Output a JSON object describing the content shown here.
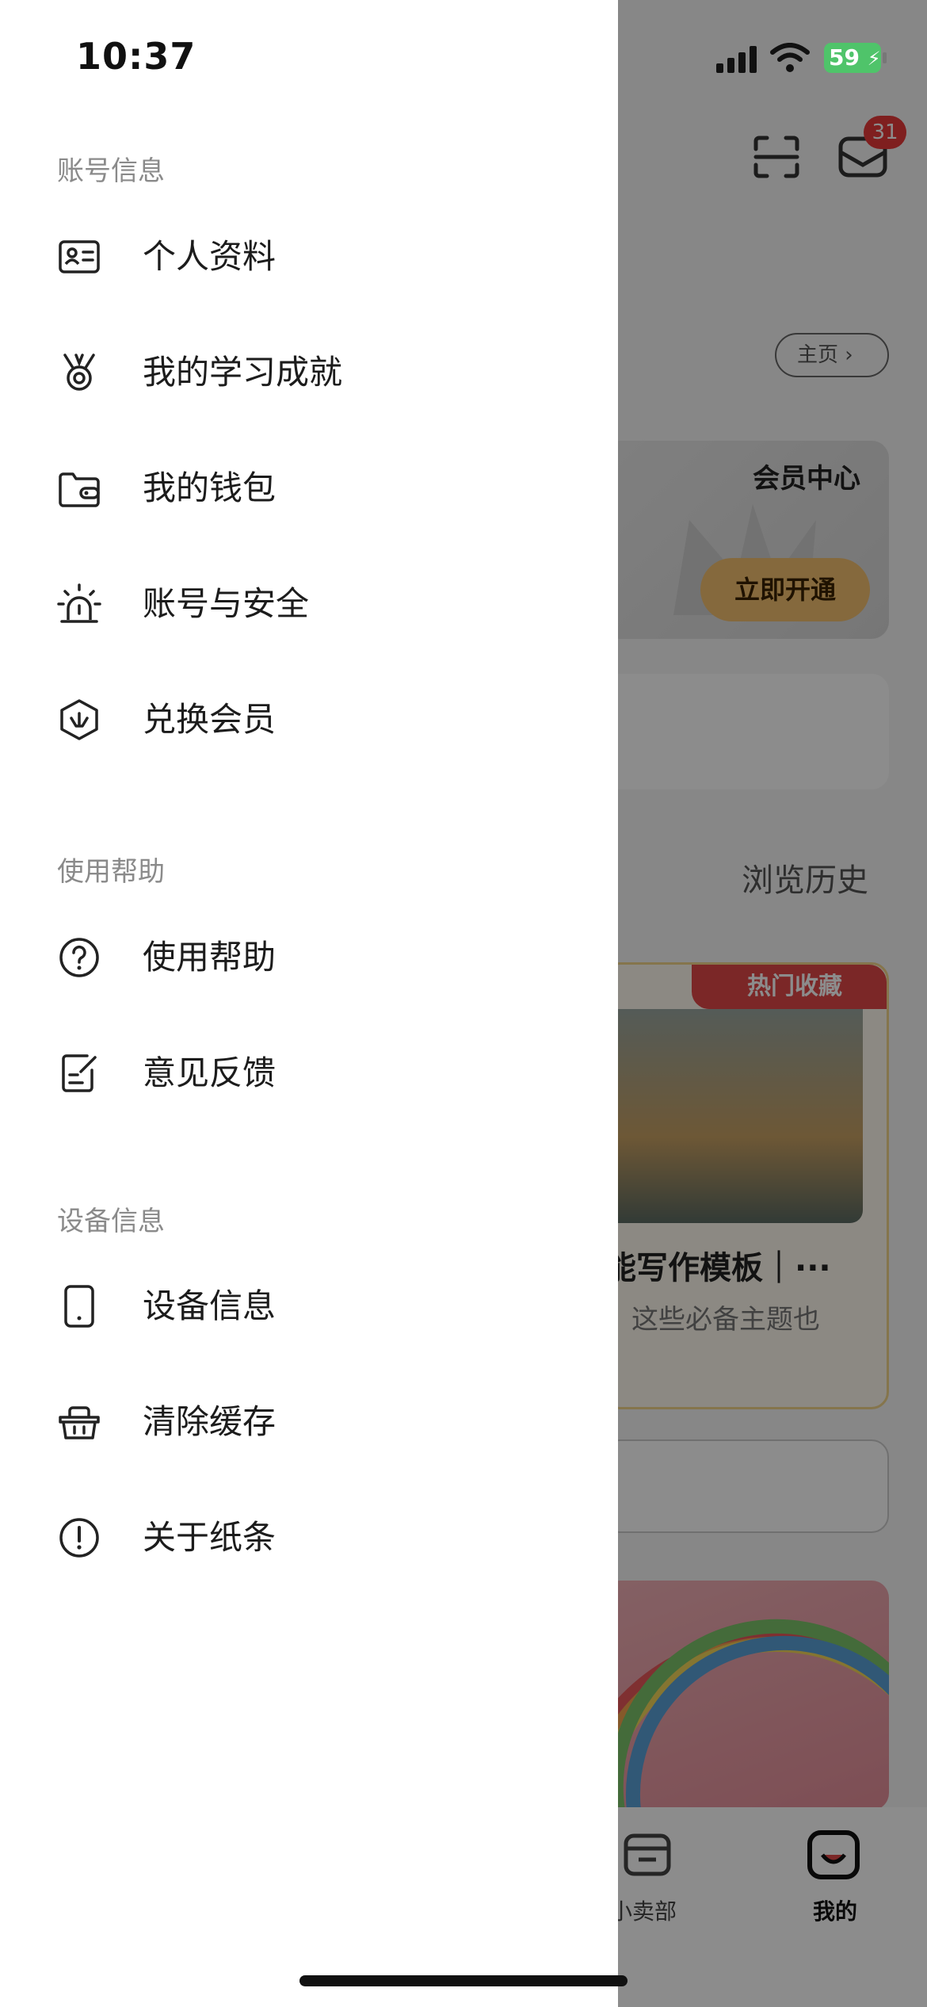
{
  "status_bar": {
    "time": "10:37",
    "battery_level": "59"
  },
  "drawer": {
    "sections": [
      {
        "title": "账号信息",
        "items": [
          {
            "label": "个人资料",
            "icon": "id-card-icon"
          },
          {
            "label": "我的学习成就",
            "icon": "medal-icon"
          },
          {
            "label": "我的钱包",
            "icon": "wallet-icon"
          },
          {
            "label": "账号与安全",
            "icon": "alarm-light-icon"
          },
          {
            "label": "兑换会员",
            "icon": "member-badge-icon"
          }
        ]
      },
      {
        "title": "使用帮助",
        "items": [
          {
            "label": "使用帮助",
            "icon": "question-circle-icon"
          },
          {
            "label": "意见反馈",
            "icon": "feedback-edit-icon"
          }
        ]
      },
      {
        "title": "设备信息",
        "items": [
          {
            "label": "设备信息",
            "icon": "phone-device-icon"
          },
          {
            "label": "清除缓存",
            "icon": "basket-icon"
          },
          {
            "label": "关于纸条",
            "icon": "info-circle-icon"
          }
        ]
      }
    ]
  },
  "background": {
    "mail_badge_count": "31",
    "home_link": "主页",
    "member_center_title": "会员中心",
    "member_cta": "立即开通",
    "history_link": "浏览历史",
    "hot_badge": "热门收藏",
    "feature_title": "能写作模板｜···",
    "feature_subtitle": "，这些必备主题也",
    "tabs": [
      {
        "label": "小卖部",
        "icon": "shop-icon"
      },
      {
        "label": "我的",
        "icon": "profile-face-icon"
      }
    ]
  },
  "colors": {
    "accent_gold": "#f2c070",
    "badge_red": "#e83a3a",
    "battery_green": "#4fc46a"
  }
}
